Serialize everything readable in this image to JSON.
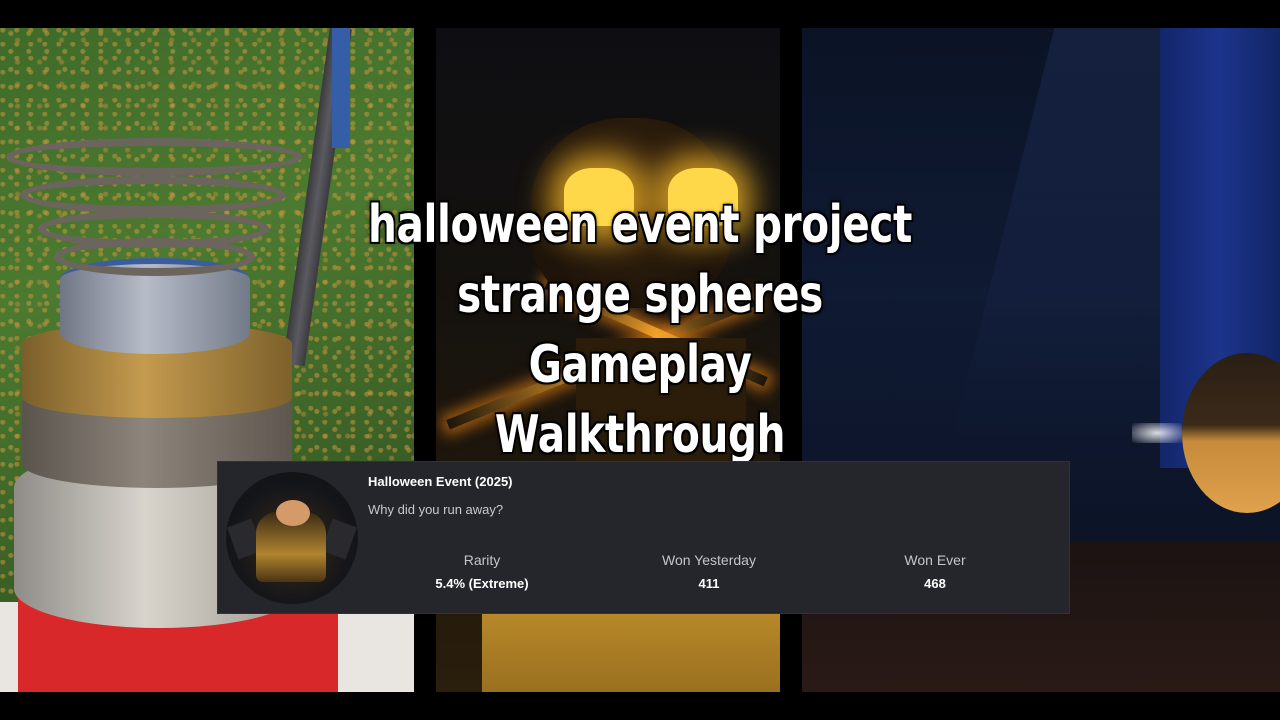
{
  "title": {
    "line1": "halloween event project",
    "line2": "strange spheres Gameplay",
    "line3": "Walkthrough"
  },
  "badge": {
    "name": "Halloween Event (2025)",
    "description": "Why did you run away?",
    "stats": [
      {
        "label": "Rarity",
        "value": "5.4% (Extreme)"
      },
      {
        "label": "Won Yesterday",
        "value": "411"
      },
      {
        "label": "Won Ever",
        "value": "468"
      }
    ]
  },
  "colors": {
    "card_bg": "#24262c",
    "glow": "#ffd84a",
    "text": "#ffffff"
  }
}
